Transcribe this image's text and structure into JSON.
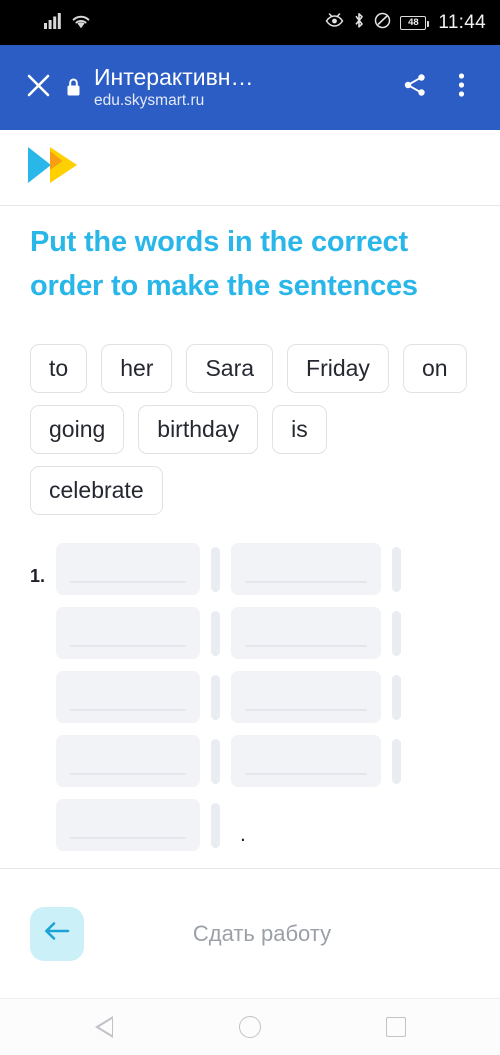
{
  "status_bar": {
    "time": "11:44",
    "battery_level": "48",
    "icons": [
      "signal-bars-icon",
      "wifi-icon",
      "eye-off-icon",
      "bluetooth-icon",
      "do-not-disturb-icon",
      "battery-icon"
    ]
  },
  "app_bar": {
    "close_icon": "close-icon",
    "lock_icon": "lock-icon",
    "title": "Интерактивн…",
    "url": "edu.skysmart.ru",
    "share_icon": "share-icon",
    "menu_icon": "overflow-menu-icon",
    "background_color": "#2c5dc4"
  },
  "content": {
    "logo": "skysmart-logo",
    "logo_colors": {
      "blue": "#29b6e8",
      "yellow": "#ffd000",
      "overlap": "#f79b16"
    },
    "task_title": "Put the words in the correct order to make the sentences",
    "task_title_color": "#29b6e8",
    "word_chips": [
      {
        "label": "to"
      },
      {
        "label": "her"
      },
      {
        "label": "Sara"
      },
      {
        "label": "Friday"
      },
      {
        "label": "on"
      },
      {
        "label": "going"
      },
      {
        "label": "birthday"
      },
      {
        "label": "is"
      },
      {
        "label": "celebrate"
      }
    ],
    "answer": {
      "number": "1.",
      "slot_value": "",
      "terminal_punctuation": ".",
      "rows": [
        {
          "number": "1.",
          "slots": 2
        },
        {
          "number": "",
          "slots": 2
        },
        {
          "number": "",
          "slots": 2
        },
        {
          "number": "",
          "slots": 2
        },
        {
          "number": "",
          "slots": 1
        }
      ]
    }
  },
  "bottom_bar": {
    "back_icon": "arrow-left-icon",
    "back_button_color": "#ccf0f7",
    "submit_label": "Сдать работу",
    "submit_label_color": "#9ba0a8"
  },
  "nav_bar": {
    "back_icon": "android-back-icon",
    "home_icon": "android-home-icon",
    "recents_icon": "android-recents-icon"
  }
}
